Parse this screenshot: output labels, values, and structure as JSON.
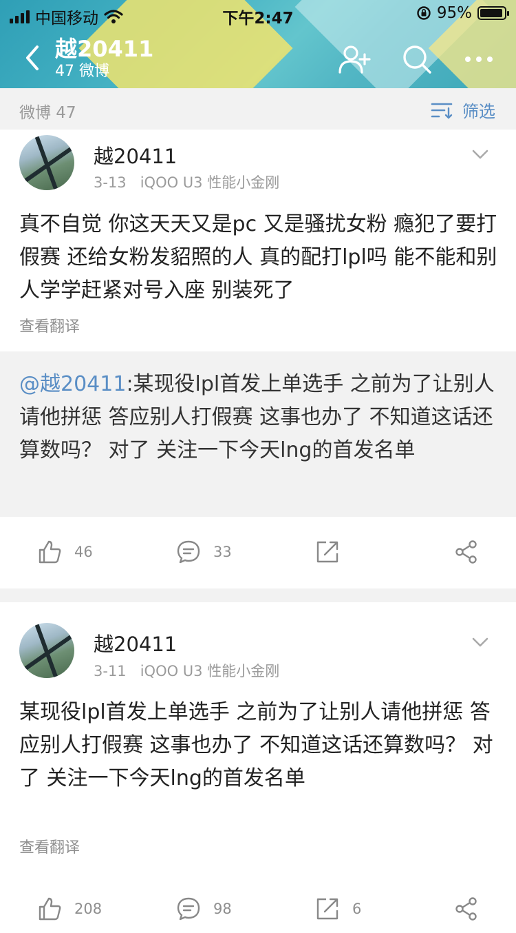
{
  "status_bar": {
    "carrier": "中国移动",
    "time": "下午2:47",
    "battery": "95%",
    "battery_level": 0.95
  },
  "header": {
    "profile_name": "越20411",
    "weibo_count": "47 微博"
  },
  "filter_bar": {
    "label": "微博 47",
    "filter": "筛选"
  },
  "posts": [
    {
      "author": "越20411",
      "date": "3-13",
      "source": "iQOO U3 性能小金刚",
      "text": "真不自觉 你这天天又是pc 又是骚扰女粉 瘾犯了要打假赛 还给女粉发貂照的人 真的配打lpl吗 能不能和别人学学赶紧对号入座 别装死了",
      "translate": "查看翻译",
      "quote": {
        "mention": "@越20411",
        "text": ":某现役lpl首发上单选手 之前为了让别人请他拼惩 答应别人打假赛 这事也办了 不知道这话还算数吗？ 对了 关注一下今天lng的首发名单"
      },
      "likes": "46",
      "comments": "33",
      "reposts": ""
    },
    {
      "author": "越20411",
      "date": "3-11",
      "source": "iQOO U3 性能小金刚",
      "text": "某现役lpl首发上单选手 之前为了让别人请他拼惩 答应别人打假赛 这事也办了 不知道这话还算数吗？ 对了 关注一下今天lng的首发名单",
      "translate": "查看翻译",
      "likes": "208",
      "comments": "98",
      "reposts": "6"
    }
  ]
}
